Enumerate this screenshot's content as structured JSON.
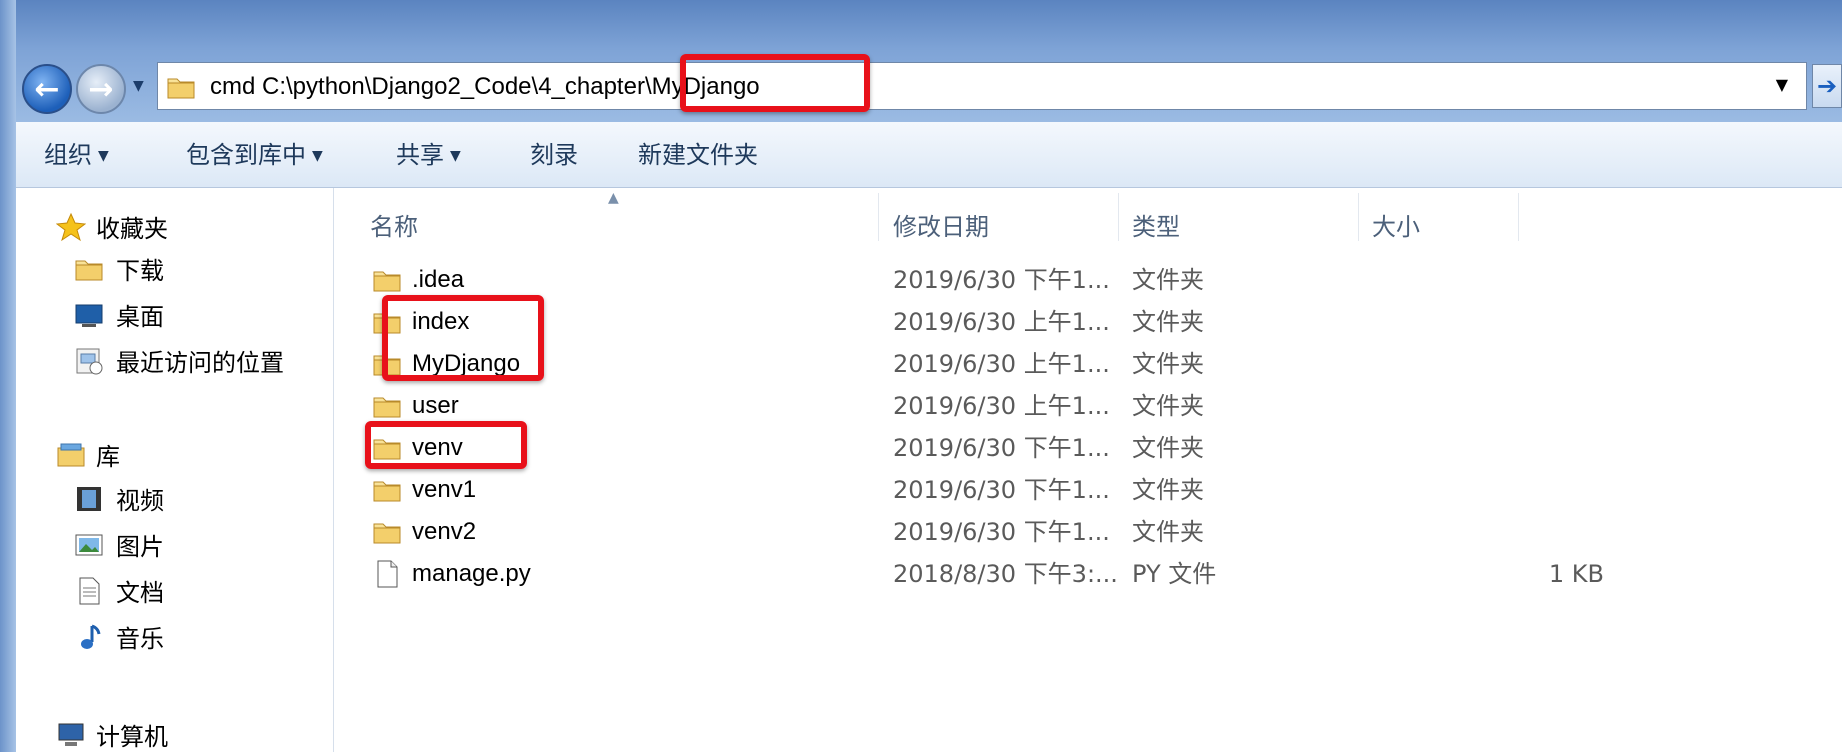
{
  "address_bar": {
    "typed_text": "cmd C:\\python\\Django2_Code\\4_chapter\\MyDjango"
  },
  "toolbar": {
    "items": [
      {
        "label": "组织",
        "has_dropdown": true
      },
      {
        "label": "包含到库中",
        "has_dropdown": true
      },
      {
        "label": "共享",
        "has_dropdown": true
      },
      {
        "label": "刻录",
        "has_dropdown": false
      },
      {
        "label": "新建文件夹",
        "has_dropdown": false
      }
    ]
  },
  "nav_pane": {
    "favorites": {
      "label": "收藏夹",
      "icon": "star-icon"
    },
    "favorite_items": [
      {
        "label": "下载",
        "icon": "folder-icon"
      },
      {
        "label": "桌面",
        "icon": "desktop-icon"
      },
      {
        "label": "最近访问的位置",
        "icon": "recent-places-icon"
      }
    ],
    "libraries": {
      "label": "库",
      "icon": "library-icon"
    },
    "library_items": [
      {
        "label": "视频",
        "icon": "video-icon"
      },
      {
        "label": "图片",
        "icon": "picture-icon"
      },
      {
        "label": "文档",
        "icon": "document-icon"
      },
      {
        "label": "音乐",
        "icon": "music-icon"
      }
    ],
    "computer": {
      "label": "计算机",
      "icon": "computer-icon"
    }
  },
  "file_list": {
    "headers": {
      "name": "名称",
      "modified": "修改日期",
      "type": "类型",
      "size": "大小"
    },
    "rows": [
      {
        "name": ".idea",
        "modified": "2019/6/30 下午1...",
        "type": "文件夹",
        "size": "",
        "icon": "folder-icon"
      },
      {
        "name": "index",
        "modified": "2019/6/30 上午1...",
        "type": "文件夹",
        "size": "",
        "icon": "folder-icon"
      },
      {
        "name": "MyDjango",
        "modified": "2019/6/30 上午1...",
        "type": "文件夹",
        "size": "",
        "icon": "folder-icon"
      },
      {
        "name": "user",
        "modified": "2019/6/30 上午1...",
        "type": "文件夹",
        "size": "",
        "icon": "folder-icon"
      },
      {
        "name": "venv",
        "modified": "2019/6/30 下午1...",
        "type": "文件夹",
        "size": "",
        "icon": "folder-icon"
      },
      {
        "name": "venv1",
        "modified": "2019/6/30 下午1...",
        "type": "文件夹",
        "size": "",
        "icon": "folder-icon"
      },
      {
        "name": "venv2",
        "modified": "2019/6/30 下午1...",
        "type": "文件夹",
        "size": "",
        "icon": "folder-icon"
      },
      {
        "name": "manage.py",
        "modified": "2018/8/30 下午3:...",
        "type": "PY 文件",
        "size": "1 KB",
        "icon": "file-icon"
      }
    ]
  },
  "highlight_color": "#e8111a"
}
